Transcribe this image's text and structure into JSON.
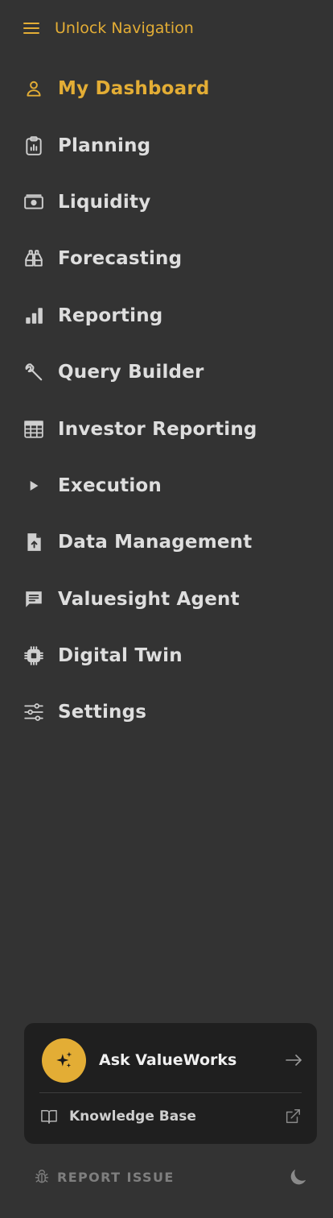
{
  "top": {
    "unlock_label": "Unlock Navigation",
    "menu_icon": "hamburger-menu-icon"
  },
  "nav": {
    "items": [
      {
        "label": "My Dashboard",
        "icon": "user-icon",
        "active": true
      },
      {
        "label": "Planning",
        "icon": "clipboard-chart-icon",
        "active": false
      },
      {
        "label": "Liquidity",
        "icon": "cash-icon",
        "active": false
      },
      {
        "label": "Forecasting",
        "icon": "binoculars-icon",
        "active": false
      },
      {
        "label": "Reporting",
        "icon": "bar-chart-icon",
        "active": false
      },
      {
        "label": "Query Builder",
        "icon": "wrench-icon",
        "active": false
      },
      {
        "label": "Investor Reporting",
        "icon": "table-icon",
        "active": false
      },
      {
        "label": "Execution",
        "icon": "play-icon",
        "active": false
      },
      {
        "label": "Data Management",
        "icon": "file-upload-icon",
        "active": false
      },
      {
        "label": "Valuesight Agent",
        "icon": "chat-icon",
        "active": false
      },
      {
        "label": "Digital Twin",
        "icon": "chip-icon",
        "active": false
      },
      {
        "label": "Settings",
        "icon": "sliders-icon",
        "active": false
      }
    ]
  },
  "assistant": {
    "ask_label": "Ask ValueWorks",
    "knowledge_base_label": "Knowledge Base",
    "ask_icon": "sparkles-icon",
    "arrow_icon": "arrow-right-icon",
    "book_icon": "book-icon",
    "external_icon": "external-link-icon"
  },
  "footer": {
    "report_issue_label": "REPORT ISSUE",
    "bug_icon": "bug-icon",
    "theme_icon": "moon-icon"
  },
  "colors": {
    "background": "#333333",
    "accent": "#e3ad35",
    "card": "#1f1f1f",
    "text": "#dedede",
    "muted": "#7f7f7f"
  }
}
